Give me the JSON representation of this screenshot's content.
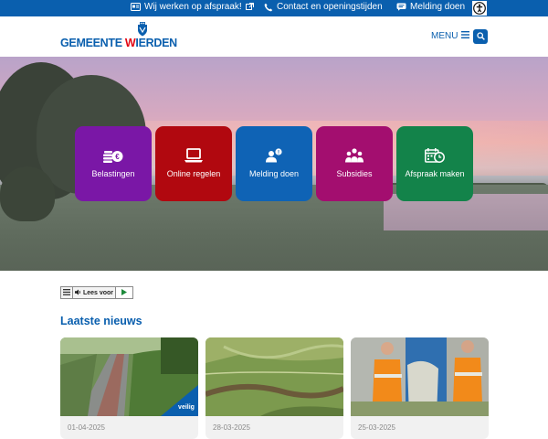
{
  "topbar": {
    "work_label": "Wij werken op afspraak!",
    "contact_label": "Contact en openingstijden",
    "report_label": "Melding doen"
  },
  "header": {
    "logo_part1": "GEMEENTE ",
    "logo_part2_accent": "W",
    "logo_part3": "IERDEN",
    "menu_label": "MENU"
  },
  "tiles": [
    {
      "label": "Belastingen",
      "color": "#7a17a6",
      "icon": "coins-euro-icon"
    },
    {
      "label": "Online regelen",
      "color": "#b1080f",
      "icon": "laptop-icon"
    },
    {
      "label": "Melding doen",
      "color": "#0f63b5",
      "icon": "person-alert-icon"
    },
    {
      "label": "Subsidies",
      "color": "#a30e6f",
      "icon": "people-group-icon"
    },
    {
      "label": "Afspraak maken",
      "color": "#13834a",
      "icon": "calendar-clock-icon"
    }
  ],
  "readspeaker": {
    "label": "Lees voor"
  },
  "news": {
    "heading": "Laatste nieuws",
    "items": [
      {
        "date": "01-04-2025",
        "badge": "veilig"
      },
      {
        "date": "28-03-2025"
      },
      {
        "date": "25-03-2025"
      }
    ]
  },
  "colors": {
    "brand_blue": "#0a5fae",
    "brand_red": "#e30613"
  }
}
